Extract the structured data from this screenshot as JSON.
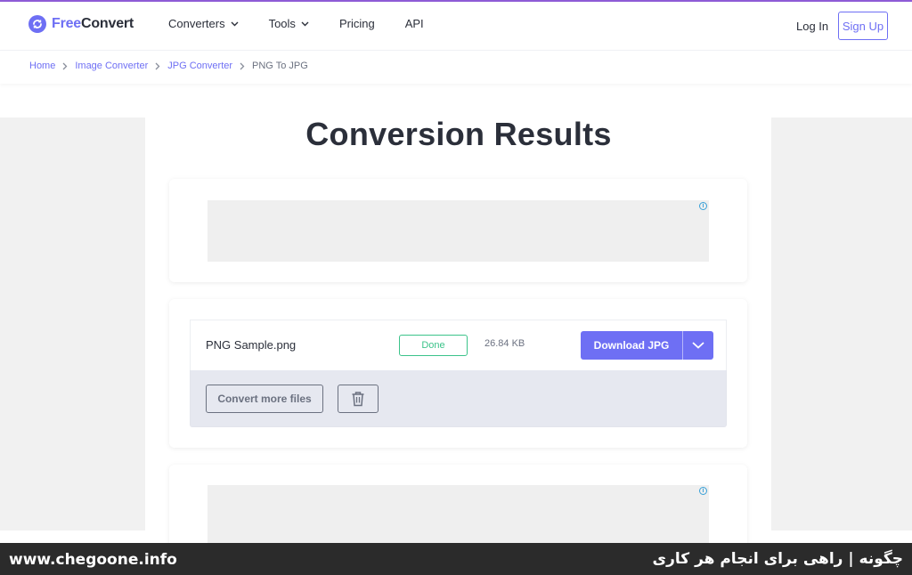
{
  "header": {
    "logo": {
      "free": "Free",
      "convert": "Convert"
    },
    "nav": [
      {
        "label": "Converters",
        "has_dropdown": true
      },
      {
        "label": "Tools",
        "has_dropdown": true
      },
      {
        "label": "Pricing",
        "has_dropdown": false
      },
      {
        "label": "API",
        "has_dropdown": false
      }
    ],
    "login_label": "Log In",
    "signup_label": "Sign Up"
  },
  "breadcrumb": [
    "Home",
    "Image Converter",
    "JPG Converter",
    "PNG To JPG"
  ],
  "page_title": "Conversion Results",
  "result": {
    "file_name": "PNG Sample.png",
    "status": "Done",
    "size": "26.84 KB",
    "download_label": "Download JPG",
    "convert_more_label": "Convert more files"
  },
  "ads": {
    "info_glyph": "i"
  },
  "watermark": {
    "left": "www.chegoone.info",
    "right": "چگونه | راهی برای انجام هر کاری"
  },
  "colors": {
    "accent": "#6e6ff4",
    "status_done": "#3cc38a",
    "text_dark": "#2b2f3a",
    "muted": "#6b7180"
  },
  "icons": [
    "freeconvert-logo-icon",
    "chevron-down-icon",
    "chevron-right-icon",
    "trash-icon",
    "ad-info-icon"
  ]
}
